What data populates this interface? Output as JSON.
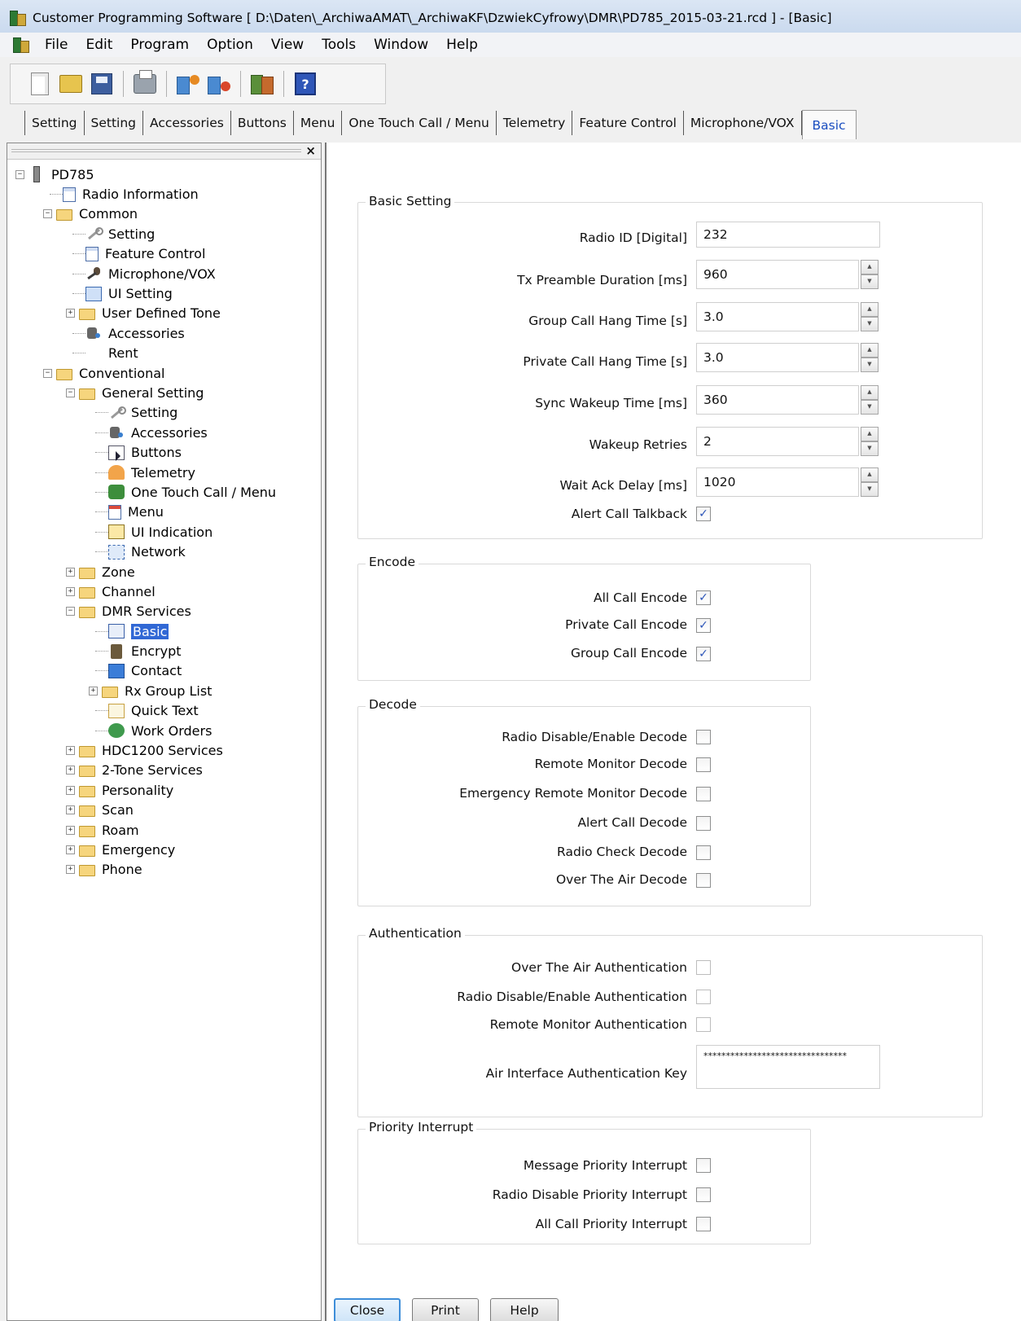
{
  "window": {
    "title": "Customer Programming Software [ D:\\Daten\\_ArchiwaAMAT\\_ArchiwaKF\\DzwiekCyfrowy\\DMR\\PD785_2015-03-21.rcd ] - [Basic]"
  },
  "menu": [
    "File",
    "Edit",
    "Program",
    "Option",
    "View",
    "Tools",
    "Window",
    "Help"
  ],
  "toolbar": {
    "buttons": [
      "new-icon",
      "open-icon",
      "save-icon",
      "print-icon",
      "read-icon",
      "write-icon",
      "clone-icon",
      "help-icon"
    ],
    "help_glyph": "?"
  },
  "tabs": [
    "Setting",
    "Setting",
    "Accessories",
    "Buttons",
    "Menu",
    "One Touch Call / Menu",
    "Telemetry",
    "Feature Control",
    "Microphone/VOX",
    "Basic"
  ],
  "tree": {
    "close_glyph": "×",
    "nodes": [
      {
        "label": "PD785",
        "expander": "−"
      },
      {
        "label": "Radio Information",
        "expander": ""
      },
      {
        "label": "Common",
        "expander": "−"
      },
      {
        "label": "Setting",
        "expander": ""
      },
      {
        "label": "Feature Control",
        "expander": ""
      },
      {
        "label": "Microphone/VOX",
        "expander": ""
      },
      {
        "label": "UI Setting",
        "expander": ""
      },
      {
        "label": "User Defined Tone",
        "expander": "+"
      },
      {
        "label": "Accessories",
        "expander": ""
      },
      {
        "label": "Rent",
        "expander": ""
      },
      {
        "label": "Conventional",
        "expander": "−"
      },
      {
        "label": "General Setting",
        "expander": "−"
      },
      {
        "label": "Setting",
        "expander": ""
      },
      {
        "label": "Accessories",
        "expander": ""
      },
      {
        "label": "Buttons",
        "expander": ""
      },
      {
        "label": "Telemetry",
        "expander": ""
      },
      {
        "label": "One Touch Call / Menu",
        "expander": ""
      },
      {
        "label": "Menu",
        "expander": ""
      },
      {
        "label": "UI Indication",
        "expander": ""
      },
      {
        "label": "Network",
        "expander": ""
      },
      {
        "label": "Zone",
        "expander": "+"
      },
      {
        "label": "Channel",
        "expander": "+"
      },
      {
        "label": "DMR Services",
        "expander": "−"
      },
      {
        "label": "Basic",
        "expander": ""
      },
      {
        "label": "Encrypt",
        "expander": ""
      },
      {
        "label": "Contact",
        "expander": ""
      },
      {
        "label": "Rx Group List",
        "expander": "+"
      },
      {
        "label": "Quick Text",
        "expander": ""
      },
      {
        "label": "Work Orders",
        "expander": ""
      },
      {
        "label": "HDC1200 Services",
        "expander": "+"
      },
      {
        "label": "2-Tone Services",
        "expander": "+"
      },
      {
        "label": "Personality",
        "expander": "+"
      },
      {
        "label": "Scan",
        "expander": "+"
      },
      {
        "label": "Roam",
        "expander": "+"
      },
      {
        "label": "Emergency",
        "expander": "+"
      },
      {
        "label": "Phone",
        "expander": "+"
      }
    ]
  },
  "basic_setting": {
    "legend": "Basic Setting",
    "radio_id": {
      "label": "Radio ID [Digital]",
      "value": "232"
    },
    "tx_preamble": {
      "label": "Tx Preamble Duration [ms]",
      "value": "960"
    },
    "group_hang": {
      "label": "Group Call Hang Time [s]",
      "value": "3.0"
    },
    "private_hang": {
      "label": "Private Call Hang Time [s]",
      "value": "3.0"
    },
    "sync_wakeup": {
      "label": "Sync Wakeup Time [ms]",
      "value": "360"
    },
    "wakeup_retries": {
      "label": "Wakeup Retries",
      "value": "2"
    },
    "wait_ack": {
      "label": "Wait Ack Delay [ms]",
      "value": "1020"
    },
    "alert_talkback": {
      "label": "Alert Call Talkback",
      "checked": true
    },
    "spin_up": "▲",
    "spin_down": "▼"
  },
  "encode": {
    "legend": "Encode",
    "all_call": {
      "label": "All Call Encode",
      "checked": true
    },
    "private_call": {
      "label": "Private Call Encode",
      "checked": true
    },
    "group_call": {
      "label": "Group Call Encode",
      "checked": true
    }
  },
  "decode": {
    "legend": "Decode",
    "radio_disable": {
      "label": "Radio Disable/Enable Decode",
      "checked": false
    },
    "remote_monitor": {
      "label": "Remote Monitor Decode",
      "checked": false
    },
    "emergency_monitor": {
      "label": "Emergency Remote Monitor Decode",
      "checked": false
    },
    "alert_call": {
      "label": "Alert Call Decode",
      "checked": false
    },
    "radio_check": {
      "label": "Radio Check Decode",
      "checked": false
    },
    "ota": {
      "label": "Over The Air Decode",
      "checked": false
    }
  },
  "authentication": {
    "legend": "Authentication",
    "ota": {
      "label": "Over The Air Authentication",
      "checked": false
    },
    "radio_disable": {
      "label": "Radio Disable/Enable Authentication",
      "checked": false
    },
    "remote_monitor": {
      "label": "Remote Monitor Authentication",
      "checked": false
    },
    "key": {
      "label": "Air Interface Authentication Key",
      "value": "********************************"
    }
  },
  "priority_interrupt": {
    "legend": "Priority Interrupt",
    "message": {
      "label": "Message Priority Interrupt",
      "checked": false
    },
    "radio_disable": {
      "label": "Radio Disable Priority Interrupt",
      "checked": false
    },
    "all_call": {
      "label": "All Call Priority Interrupt",
      "checked": false
    }
  },
  "buttons": {
    "close": "Close",
    "print": "Print",
    "help": "Help"
  },
  "check_glyph": "✓"
}
